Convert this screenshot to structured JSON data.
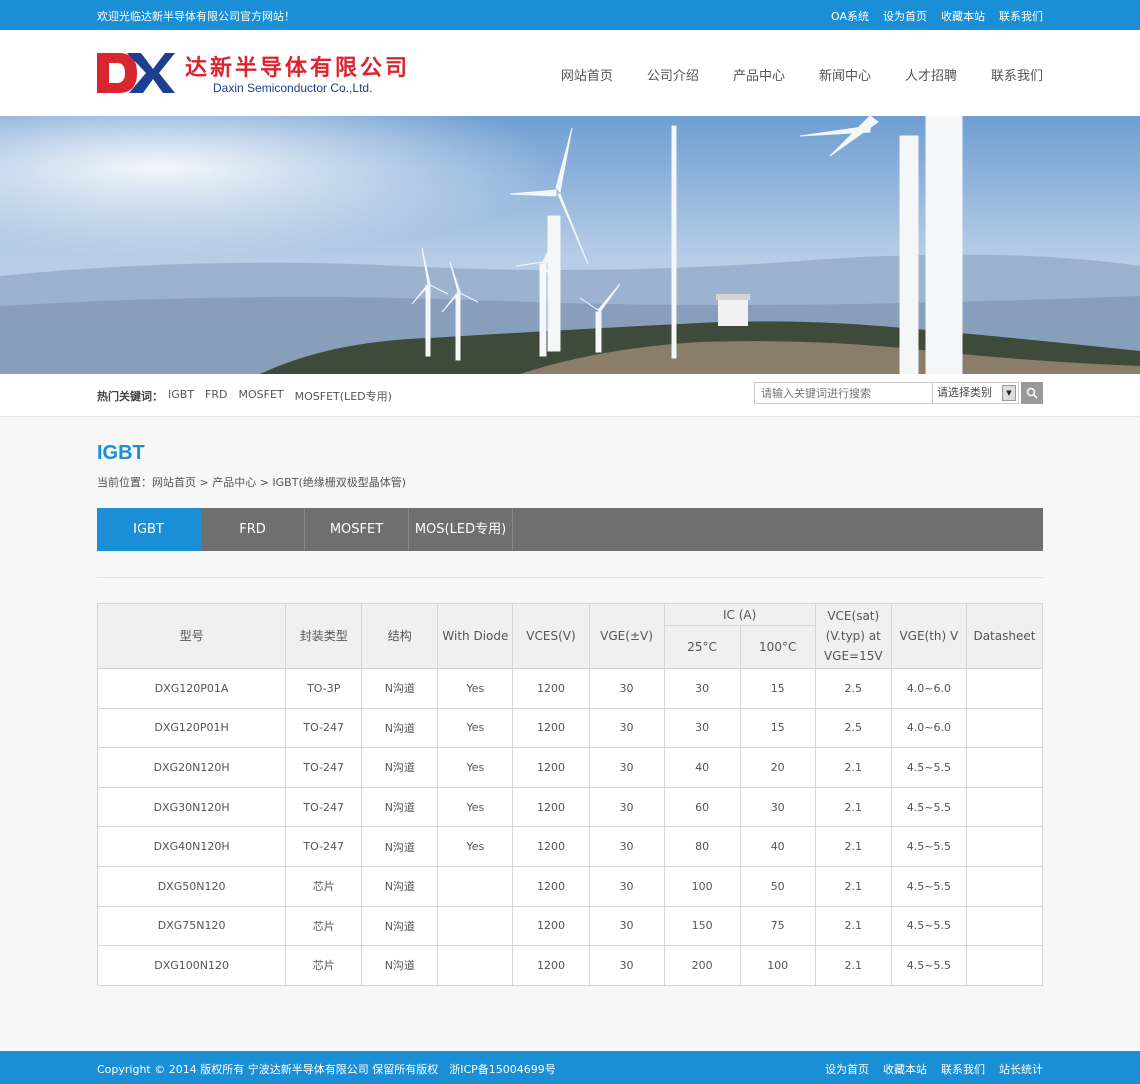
{
  "topbar": {
    "welcome": "欢迎光临达新半导体有限公司官方网站！",
    "links": [
      "OA系统",
      "设为首页",
      "收藏本站",
      "联系我们"
    ]
  },
  "logo": {
    "name_cn": "达新半导体有限公司",
    "name_en": "Daxin Semiconductor Co.,Ltd."
  },
  "nav": [
    "网站首页",
    "公司介绍",
    "产品中心",
    "新闻中心",
    "人才招聘",
    "联系我们"
  ],
  "hot_keywords": {
    "label": "热门关键词：",
    "items": [
      "IGBT",
      "FRD",
      "MOSFET",
      "MOSFET(LED专用)"
    ]
  },
  "search": {
    "placeholder": "请输入关键词进行搜索",
    "category": "请选择类别"
  },
  "page_title": "IGBT",
  "breadcrumb": "当前位置：网站首页 > 产品中心 > IGBT(绝缘栅双极型晶体管)",
  "tabs": [
    "IGBT",
    "FRD",
    "MOSFET",
    "MOS(LED专用)"
  ],
  "table": {
    "headers": {
      "model": "型号",
      "package": "封装类型",
      "structure": "结构",
      "diode": "With Diode",
      "vces": "VCES(V)",
      "vge": "VGE(±V)",
      "ic": "IC (A)",
      "t25": "25°C",
      "t100": "100°C",
      "vce_line1": "VCE(sat)",
      "vce_line2": "(V.typ) at",
      "vce_line3": "VGE=15V",
      "vgeth": "VGE(th) V",
      "datasheet": "Datasheet"
    },
    "rows": [
      [
        "DXG120P01A",
        "TO-3P",
        "N沟道",
        "Yes",
        "1200",
        "30",
        "30",
        "15",
        "2.5",
        "4.0~6.0",
        ""
      ],
      [
        "DXG120P01H",
        "TO-247",
        "N沟道",
        "Yes",
        "1200",
        "30",
        "30",
        "15",
        "2.5",
        "4.0~6.0",
        ""
      ],
      [
        "DXG20N120H",
        "TO-247",
        "N沟道",
        "Yes",
        "1200",
        "30",
        "40",
        "20",
        "2.1",
        "4.5~5.5",
        ""
      ],
      [
        "DXG30N120H",
        "TO-247",
        "N沟道",
        "Yes",
        "1200",
        "30",
        "60",
        "30",
        "2.1",
        "4.5~5.5",
        ""
      ],
      [
        "DXG40N120H",
        "TO-247",
        "N沟道",
        "Yes",
        "1200",
        "30",
        "80",
        "40",
        "2.1",
        "4.5~5.5",
        ""
      ],
      [
        "DXG50N120",
        "芯片",
        "N沟道",
        "",
        "1200",
        "30",
        "100",
        "50",
        "2.1",
        "4.5~5.5",
        ""
      ],
      [
        "DXG75N120",
        "芯片",
        "N沟道",
        "",
        "1200",
        "30",
        "150",
        "75",
        "2.1",
        "4.5~5.5",
        ""
      ],
      [
        "DXG100N120",
        "芯片",
        "N沟道",
        "",
        "1200",
        "30",
        "200",
        "100",
        "2.1",
        "4.5~5.5",
        ""
      ]
    ]
  },
  "footer": {
    "copyright": "Copyright © 2014 版权所有 宁波达新半导体有限公司 保留所有版权　浙ICP备15004699号",
    "links": [
      "设为首页",
      "收藏本站",
      "联系我们",
      "站长统计"
    ]
  },
  "colors": {
    "brand_blue": "#1a8fd6",
    "logo_red": "#d9252f",
    "logo_navy": "#1c3f8f",
    "tab_gray": "#6f6f6f"
  }
}
